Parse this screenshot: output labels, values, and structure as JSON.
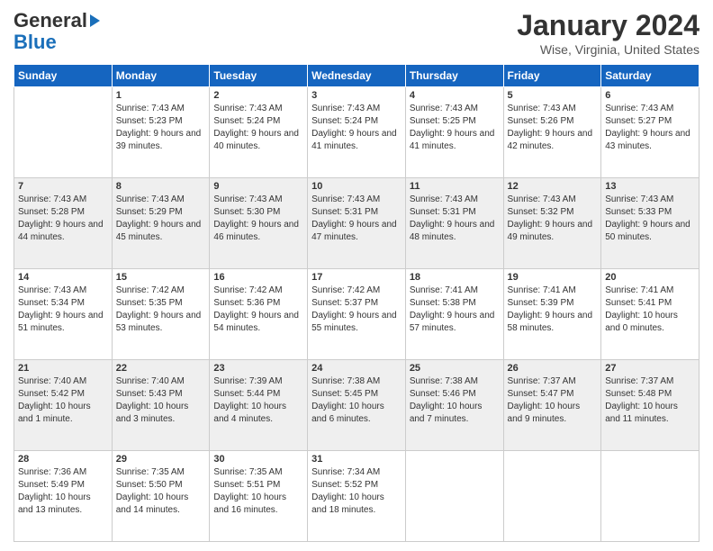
{
  "header": {
    "logo_line1": "General",
    "logo_line2": "Blue",
    "title": "January 2024",
    "subtitle": "Wise, Virginia, United States"
  },
  "days": [
    "Sunday",
    "Monday",
    "Tuesday",
    "Wednesday",
    "Thursday",
    "Friday",
    "Saturday"
  ],
  "weeks": [
    [
      {
        "date": "",
        "sunrise": "",
        "sunset": "",
        "daylight": ""
      },
      {
        "date": "1",
        "sunrise": "Sunrise: 7:43 AM",
        "sunset": "Sunset: 5:23 PM",
        "daylight": "Daylight: 9 hours and 39 minutes."
      },
      {
        "date": "2",
        "sunrise": "Sunrise: 7:43 AM",
        "sunset": "Sunset: 5:24 PM",
        "daylight": "Daylight: 9 hours and 40 minutes."
      },
      {
        "date": "3",
        "sunrise": "Sunrise: 7:43 AM",
        "sunset": "Sunset: 5:24 PM",
        "daylight": "Daylight: 9 hours and 41 minutes."
      },
      {
        "date": "4",
        "sunrise": "Sunrise: 7:43 AM",
        "sunset": "Sunset: 5:25 PM",
        "daylight": "Daylight: 9 hours and 41 minutes."
      },
      {
        "date": "5",
        "sunrise": "Sunrise: 7:43 AM",
        "sunset": "Sunset: 5:26 PM",
        "daylight": "Daylight: 9 hours and 42 minutes."
      },
      {
        "date": "6",
        "sunrise": "Sunrise: 7:43 AM",
        "sunset": "Sunset: 5:27 PM",
        "daylight": "Daylight: 9 hours and 43 minutes."
      }
    ],
    [
      {
        "date": "7",
        "sunrise": "Sunrise: 7:43 AM",
        "sunset": "Sunset: 5:28 PM",
        "daylight": "Daylight: 9 hours and 44 minutes."
      },
      {
        "date": "8",
        "sunrise": "Sunrise: 7:43 AM",
        "sunset": "Sunset: 5:29 PM",
        "daylight": "Daylight: 9 hours and 45 minutes."
      },
      {
        "date": "9",
        "sunrise": "Sunrise: 7:43 AM",
        "sunset": "Sunset: 5:30 PM",
        "daylight": "Daylight: 9 hours and 46 minutes."
      },
      {
        "date": "10",
        "sunrise": "Sunrise: 7:43 AM",
        "sunset": "Sunset: 5:31 PM",
        "daylight": "Daylight: 9 hours and 47 minutes."
      },
      {
        "date": "11",
        "sunrise": "Sunrise: 7:43 AM",
        "sunset": "Sunset: 5:31 PM",
        "daylight": "Daylight: 9 hours and 48 minutes."
      },
      {
        "date": "12",
        "sunrise": "Sunrise: 7:43 AM",
        "sunset": "Sunset: 5:32 PM",
        "daylight": "Daylight: 9 hours and 49 minutes."
      },
      {
        "date": "13",
        "sunrise": "Sunrise: 7:43 AM",
        "sunset": "Sunset: 5:33 PM",
        "daylight": "Daylight: 9 hours and 50 minutes."
      }
    ],
    [
      {
        "date": "14",
        "sunrise": "Sunrise: 7:43 AM",
        "sunset": "Sunset: 5:34 PM",
        "daylight": "Daylight: 9 hours and 51 minutes."
      },
      {
        "date": "15",
        "sunrise": "Sunrise: 7:42 AM",
        "sunset": "Sunset: 5:35 PM",
        "daylight": "Daylight: 9 hours and 53 minutes."
      },
      {
        "date": "16",
        "sunrise": "Sunrise: 7:42 AM",
        "sunset": "Sunset: 5:36 PM",
        "daylight": "Daylight: 9 hours and 54 minutes."
      },
      {
        "date": "17",
        "sunrise": "Sunrise: 7:42 AM",
        "sunset": "Sunset: 5:37 PM",
        "daylight": "Daylight: 9 hours and 55 minutes."
      },
      {
        "date": "18",
        "sunrise": "Sunrise: 7:41 AM",
        "sunset": "Sunset: 5:38 PM",
        "daylight": "Daylight: 9 hours and 57 minutes."
      },
      {
        "date": "19",
        "sunrise": "Sunrise: 7:41 AM",
        "sunset": "Sunset: 5:39 PM",
        "daylight": "Daylight: 9 hours and 58 minutes."
      },
      {
        "date": "20",
        "sunrise": "Sunrise: 7:41 AM",
        "sunset": "Sunset: 5:41 PM",
        "daylight": "Daylight: 10 hours and 0 minutes."
      }
    ],
    [
      {
        "date": "21",
        "sunrise": "Sunrise: 7:40 AM",
        "sunset": "Sunset: 5:42 PM",
        "daylight": "Daylight: 10 hours and 1 minute."
      },
      {
        "date": "22",
        "sunrise": "Sunrise: 7:40 AM",
        "sunset": "Sunset: 5:43 PM",
        "daylight": "Daylight: 10 hours and 3 minutes."
      },
      {
        "date": "23",
        "sunrise": "Sunrise: 7:39 AM",
        "sunset": "Sunset: 5:44 PM",
        "daylight": "Daylight: 10 hours and 4 minutes."
      },
      {
        "date": "24",
        "sunrise": "Sunrise: 7:38 AM",
        "sunset": "Sunset: 5:45 PM",
        "daylight": "Daylight: 10 hours and 6 minutes."
      },
      {
        "date": "25",
        "sunrise": "Sunrise: 7:38 AM",
        "sunset": "Sunset: 5:46 PM",
        "daylight": "Daylight: 10 hours and 7 minutes."
      },
      {
        "date": "26",
        "sunrise": "Sunrise: 7:37 AM",
        "sunset": "Sunset: 5:47 PM",
        "daylight": "Daylight: 10 hours and 9 minutes."
      },
      {
        "date": "27",
        "sunrise": "Sunrise: 7:37 AM",
        "sunset": "Sunset: 5:48 PM",
        "daylight": "Daylight: 10 hours and 11 minutes."
      }
    ],
    [
      {
        "date": "28",
        "sunrise": "Sunrise: 7:36 AM",
        "sunset": "Sunset: 5:49 PM",
        "daylight": "Daylight: 10 hours and 13 minutes."
      },
      {
        "date": "29",
        "sunrise": "Sunrise: 7:35 AM",
        "sunset": "Sunset: 5:50 PM",
        "daylight": "Daylight: 10 hours and 14 minutes."
      },
      {
        "date": "30",
        "sunrise": "Sunrise: 7:35 AM",
        "sunset": "Sunset: 5:51 PM",
        "daylight": "Daylight: 10 hours and 16 minutes."
      },
      {
        "date": "31",
        "sunrise": "Sunrise: 7:34 AM",
        "sunset": "Sunset: 5:52 PM",
        "daylight": "Daylight: 10 hours and 18 minutes."
      },
      {
        "date": "",
        "sunrise": "",
        "sunset": "",
        "daylight": ""
      },
      {
        "date": "",
        "sunrise": "",
        "sunset": "",
        "daylight": ""
      },
      {
        "date": "",
        "sunrise": "",
        "sunset": "",
        "daylight": ""
      }
    ]
  ]
}
